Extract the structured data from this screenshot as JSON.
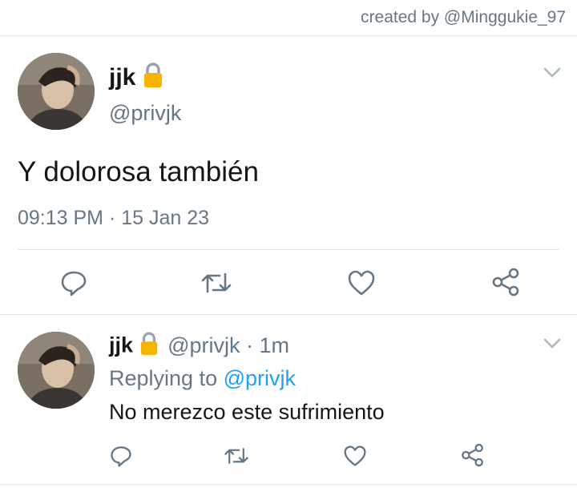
{
  "credit": "created by @Minggukie_97",
  "main_tweet": {
    "name": "jjk",
    "lock_icon": "lock-icon",
    "handle": "@privjk",
    "text": "Y dolorosa también",
    "timestamp": "09:13 PM · 15 Jan 23"
  },
  "reply_tweet": {
    "name": "jjk",
    "lock_icon": "lock-icon",
    "handle_time": "@privjk · 1m",
    "replying_prefix": "Replying to ",
    "replying_handle": "@privjk",
    "text": "No merezco este sufrimiento"
  },
  "actions": [
    "reply-icon",
    "retweet-icon",
    "like-icon",
    "share-icon"
  ],
  "colors": {
    "text": "#14171a",
    "secondary": "#657786",
    "link": "#1da1f2",
    "divider": "#e1e8ed",
    "icon": "#657786",
    "lock_body": "#f5b400"
  }
}
